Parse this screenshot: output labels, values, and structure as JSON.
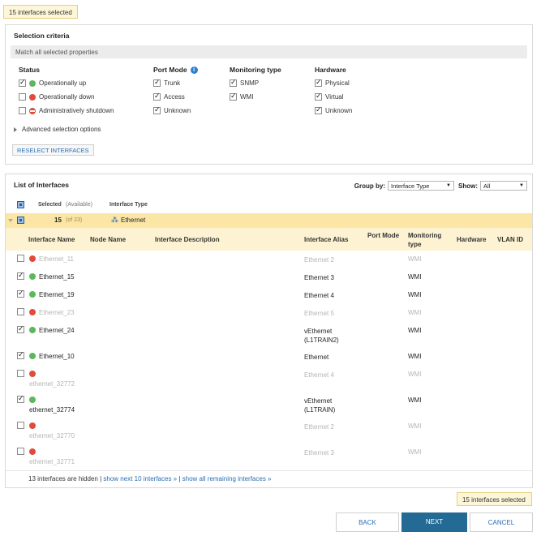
{
  "selected_badge": "15 interfaces selected",
  "criteria": {
    "title": "Selection criteria",
    "match_label": "Match all selected properties",
    "columns": {
      "status": {
        "heading": "Status",
        "items": [
          {
            "label": "Operationally up",
            "checked": true,
            "dot": "green"
          },
          {
            "label": "Operationally down",
            "checked": false,
            "dot": "red"
          },
          {
            "label": "Administratively shutdown",
            "checked": false,
            "dot": "shut"
          }
        ]
      },
      "port_mode": {
        "heading": "Port Mode",
        "items": [
          {
            "label": "Trunk",
            "checked": true
          },
          {
            "label": "Access",
            "checked": true
          },
          {
            "label": "Unknown",
            "checked": true
          }
        ]
      },
      "monitoring": {
        "heading": "Monitoring type",
        "items": [
          {
            "label": "SNMP",
            "checked": true
          },
          {
            "label": "WMI",
            "checked": true
          }
        ]
      },
      "hardware": {
        "heading": "Hardware",
        "items": [
          {
            "label": "Physical",
            "checked": true
          },
          {
            "label": "Virtual",
            "checked": true
          },
          {
            "label": "Unknown",
            "checked": true
          }
        ]
      }
    },
    "advanced": "Advanced selection options",
    "reselect": "RESELECT INTERFACES"
  },
  "list": {
    "title": "List of Interfaces",
    "group_by_label": "Group by:",
    "group_by_value": "Interface Type",
    "show_label": "Show:",
    "show_value": "All",
    "hdr_selected": "Selected",
    "hdr_available": "(Available)",
    "hdr_type": "Interface Type",
    "group_count": "15",
    "group_of": "(of 23)",
    "group_name": "Ethernet",
    "columns": [
      "Interface Name",
      "Node Name",
      "Interface Description",
      "Interface Alias",
      "Port Mode",
      "Monitoring type",
      "Hardware",
      "VLAN ID"
    ],
    "rows": [
      {
        "checked": false,
        "dot": "red",
        "name": "Ethernet_11",
        "alias": "Ethernet 2",
        "mon": "WMI",
        "dim": true
      },
      {
        "checked": true,
        "dot": "green",
        "name": "Ethernet_15",
        "alias": "Ethernet 3",
        "mon": "WMI",
        "dim": false
      },
      {
        "checked": true,
        "dot": "green",
        "name": "Ethernet_19",
        "alias": "Ethernet 4",
        "mon": "WMI",
        "dim": false
      },
      {
        "checked": false,
        "dot": "red",
        "name": "Ethernet_23",
        "alias": "Ethernet 5",
        "mon": "WMI",
        "dim": true
      },
      {
        "checked": true,
        "dot": "green",
        "name": "Ethernet_24",
        "alias": "vEthernet (L1TRAIN2)",
        "mon": "WMI",
        "dim": false
      },
      {
        "checked": true,
        "dot": "green",
        "name": "Ethernet_10",
        "alias": "Ethernet",
        "mon": "WMI",
        "dim": false
      },
      {
        "checked": false,
        "dot": "red",
        "name": "ethernet_32772",
        "alias": "Ethernet 4",
        "mon": "WMI",
        "dim": true
      },
      {
        "checked": true,
        "dot": "green",
        "name": "ethernet_32774",
        "alias": "vEthernet (L1TRAIN)",
        "mon": "WMI",
        "dim": false
      },
      {
        "checked": false,
        "dot": "red",
        "name": "ethernet_32770",
        "alias": "Ethernet 2",
        "mon": "WMI",
        "dim": true
      },
      {
        "checked": false,
        "dot": "red",
        "name": "ethernet_32771",
        "alias": "Ethernet 3",
        "mon": "WMI",
        "dim": true
      }
    ],
    "hidden_text": "13 interfaces are hidden",
    "show_next": "show next 10 interfaces »",
    "show_all": "show all remaining interfaces »",
    "separator": "|"
  },
  "buttons": {
    "back": "BACK",
    "next": "NEXT",
    "cancel": "CANCEL"
  }
}
